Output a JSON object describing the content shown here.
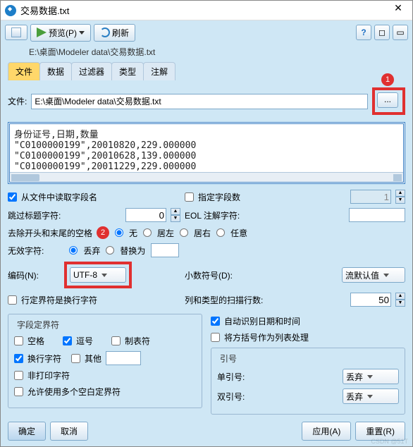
{
  "title": "交易数据.txt",
  "toolbar": {
    "preview": "预览(P)",
    "refresh": "刷新"
  },
  "path": "E:\\桌面\\Modeler data\\交易数据.txt",
  "tabs": [
    "文件",
    "数据",
    "过滤器",
    "类型",
    "注解"
  ],
  "file_label": "文件:",
  "file_value": "E:\\桌面\\Modeler data\\交易数据.txt",
  "browse": "...",
  "preview_lines": [
    "身份证号,日期,数量",
    "\"C0100000199\",20010820,229.000000",
    "\"C0100000199\",20010628,139.000000",
    "\"C0100000199\",20011229,229.000000"
  ],
  "callouts": {
    "one": "1",
    "two": "2"
  },
  "opts": {
    "read_field_names": "从文件中读取字段名",
    "specify_fields": "指定字段数",
    "specify_value": "1",
    "skip_header": "跳过标题字符:",
    "skip_value": "0",
    "eol_comment": "EOL 注解字符:",
    "strip_label": "去除开头和末尾的空格",
    "strip_none": "无",
    "strip_left": "居左",
    "strip_right": "居右",
    "strip_any": "任意",
    "invalid_label": "无效字符:",
    "invalid_discard": "丢弃",
    "invalid_replace": "替换为",
    "encoding_label": "编码(N):",
    "encoding_value": "UTF-8",
    "decimal_label": "小数符号(D):",
    "decimal_value": "流默认值",
    "row_delim": "行定界符是换行字符",
    "scan_label": "列和类型的扫描行数:",
    "scan_value": "50",
    "auto_date": "自动识别日期和时间",
    "bracket_list": "将方括号作为列表处理"
  },
  "delim": {
    "legend": "字段定界符",
    "space": "空格",
    "comma": "逗号",
    "tab": "制表符",
    "newline": "换行字符",
    "other": "其他",
    "nonprint": "非打印字符",
    "multi_blank": "允许使用多个空白定界符"
  },
  "quotes": {
    "legend": "引号",
    "single": "单引号:",
    "double": "双引号:",
    "discard": "丢弃"
  },
  "footer": {
    "ok": "确定",
    "cancel": "取消",
    "apply": "应用(A)",
    "reset": "重置(R)"
  },
  "help": "?",
  "watermark": "CSDN @51T"
}
